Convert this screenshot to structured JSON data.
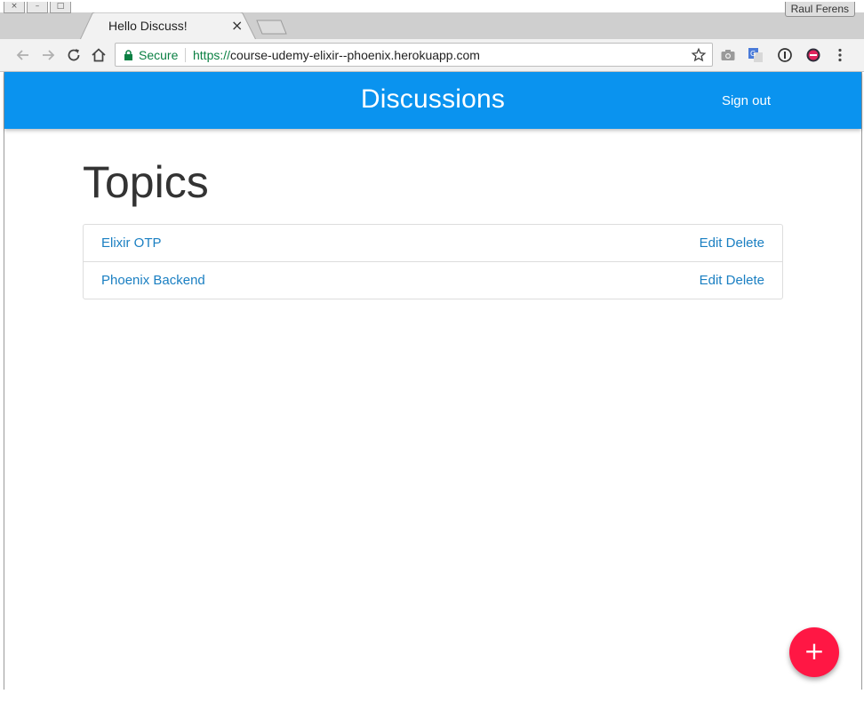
{
  "browser": {
    "window_controls": [
      "×",
      "–",
      "□"
    ],
    "profile_name": "Raul Ferens",
    "tab": {
      "title": "Hello Discuss!",
      "close_glyph": "×"
    },
    "toolbar": {
      "back_icon": "arrow-left-icon",
      "forward_icon": "arrow-right-icon",
      "reload_icon": "reload-icon",
      "home_icon": "home-icon"
    },
    "omnibox": {
      "secure_label": "Secure",
      "url_scheme": "https://",
      "url_rest": "course-udemy-elixir--phoenix.herokuapp.com"
    },
    "colors": {
      "secure_green": "#0b8043"
    }
  },
  "navbar": {
    "brand": "Discussions",
    "sign_out": "Sign out",
    "color": "#0a93ef"
  },
  "main": {
    "heading": "Topics",
    "topics": [
      {
        "title": "Elixir OTP",
        "edit": "Edit",
        "delete": "Delete"
      },
      {
        "title": "Phoenix Backend",
        "edit": "Edit",
        "delete": "Delete"
      }
    ]
  },
  "fab": {
    "label": "+",
    "color": "#ff1744"
  }
}
